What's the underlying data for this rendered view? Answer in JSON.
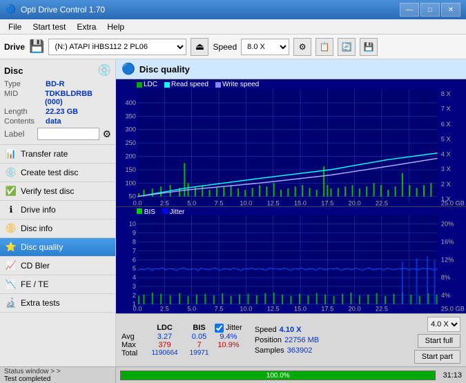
{
  "app": {
    "title": "Opti Drive Control 1.70",
    "min_label": "—",
    "max_label": "□",
    "close_label": "✕"
  },
  "menu": {
    "items": [
      "File",
      "Start test",
      "Extra",
      "Help"
    ]
  },
  "drive": {
    "label": "Drive",
    "drive_value": "(N:)  ATAPI iHBS112  2 PL06",
    "speed_label": "Speed",
    "speed_value": "8.0 X"
  },
  "disc": {
    "title": "Disc",
    "type_label": "Type",
    "type_value": "BD-R",
    "mid_label": "MID",
    "mid_value": "TDKBLDRBB (000)",
    "length_label": "Length",
    "length_value": "22.23 GB",
    "contents_label": "Contents",
    "contents_value": "data",
    "label_label": "Label",
    "label_value": ""
  },
  "sidebar": {
    "items": [
      {
        "id": "transfer-rate",
        "label": "Transfer rate",
        "icon": "📊",
        "active": false
      },
      {
        "id": "create-test-disc",
        "label": "Create test disc",
        "icon": "💿",
        "active": false
      },
      {
        "id": "verify-test-disc",
        "label": "Verify test disc",
        "icon": "✅",
        "active": false
      },
      {
        "id": "drive-info",
        "label": "Drive info",
        "icon": "ℹ️",
        "active": false
      },
      {
        "id": "disc-info",
        "label": "Disc info",
        "icon": "📀",
        "active": false
      },
      {
        "id": "disc-quality",
        "label": "Disc quality",
        "icon": "⭐",
        "active": true
      },
      {
        "id": "cd-bler",
        "label": "CD Bler",
        "icon": "📈",
        "active": false
      },
      {
        "id": "fe-te",
        "label": "FE / TE",
        "icon": "📉",
        "active": false
      },
      {
        "id": "extra-tests",
        "label": "Extra tests",
        "icon": "🔬",
        "active": false
      }
    ]
  },
  "disc_quality": {
    "header": "Disc quality",
    "legend": {
      "ldc_label": "LDC",
      "read_speed_label": "Read speed",
      "write_speed_label": "Write speed"
    },
    "upper_y_labels": [
      "400",
      "350",
      "300",
      "250",
      "200",
      "150",
      "100",
      "50"
    ],
    "upper_x_labels": [
      "0.0",
      "2.5",
      "5.0",
      "7.5",
      "10.0",
      "12.5",
      "15.0",
      "17.5",
      "20.0",
      "22.5",
      "25.0 GB"
    ],
    "right_y_labels": [
      "8 X",
      "7 X",
      "6 X",
      "5 X",
      "4 X",
      "3 X",
      "2 X",
      "1 X"
    ],
    "lower_legend": {
      "bis_label": "BIS",
      "jitter_label": "Jitter"
    },
    "lower_y_labels": [
      "10",
      "9",
      "8",
      "7",
      "6",
      "5",
      "4",
      "3",
      "2",
      "1"
    ],
    "lower_right_labels": [
      "20%",
      "16%",
      "12%",
      "8%",
      "4%"
    ],
    "lower_x_labels": [
      "0.0",
      "2.5",
      "5.0",
      "7.5",
      "10.0",
      "12.5",
      "15.0",
      "17.5",
      "20.0",
      "22.5",
      "25.0 GB"
    ]
  },
  "stats": {
    "col_headers": [
      "LDC",
      "BIS",
      "Jitter"
    ],
    "rows": [
      {
        "label": "Avg",
        "ldc": "3.27",
        "bis": "0.05",
        "jitter": "9.4%"
      },
      {
        "label": "Max",
        "ldc": "379",
        "bis": "7",
        "jitter": "10.9%"
      },
      {
        "label": "Total",
        "ldc": "1190664",
        "bis": "19971",
        "jitter": ""
      }
    ],
    "jitter_check": true,
    "speed_label": "Speed",
    "speed_value": "4.10 X",
    "speed_select": "4.0 X",
    "position_label": "Position",
    "position_value": "22756 MB",
    "samples_label": "Samples",
    "samples_value": "363902",
    "start_full_label": "Start full",
    "start_part_label": "Start part"
  },
  "status": {
    "window_label": "Status window > >",
    "test_completed_label": "Test completed",
    "progress_percent": "100.0%",
    "progress_value": 100,
    "time": "31:13"
  }
}
